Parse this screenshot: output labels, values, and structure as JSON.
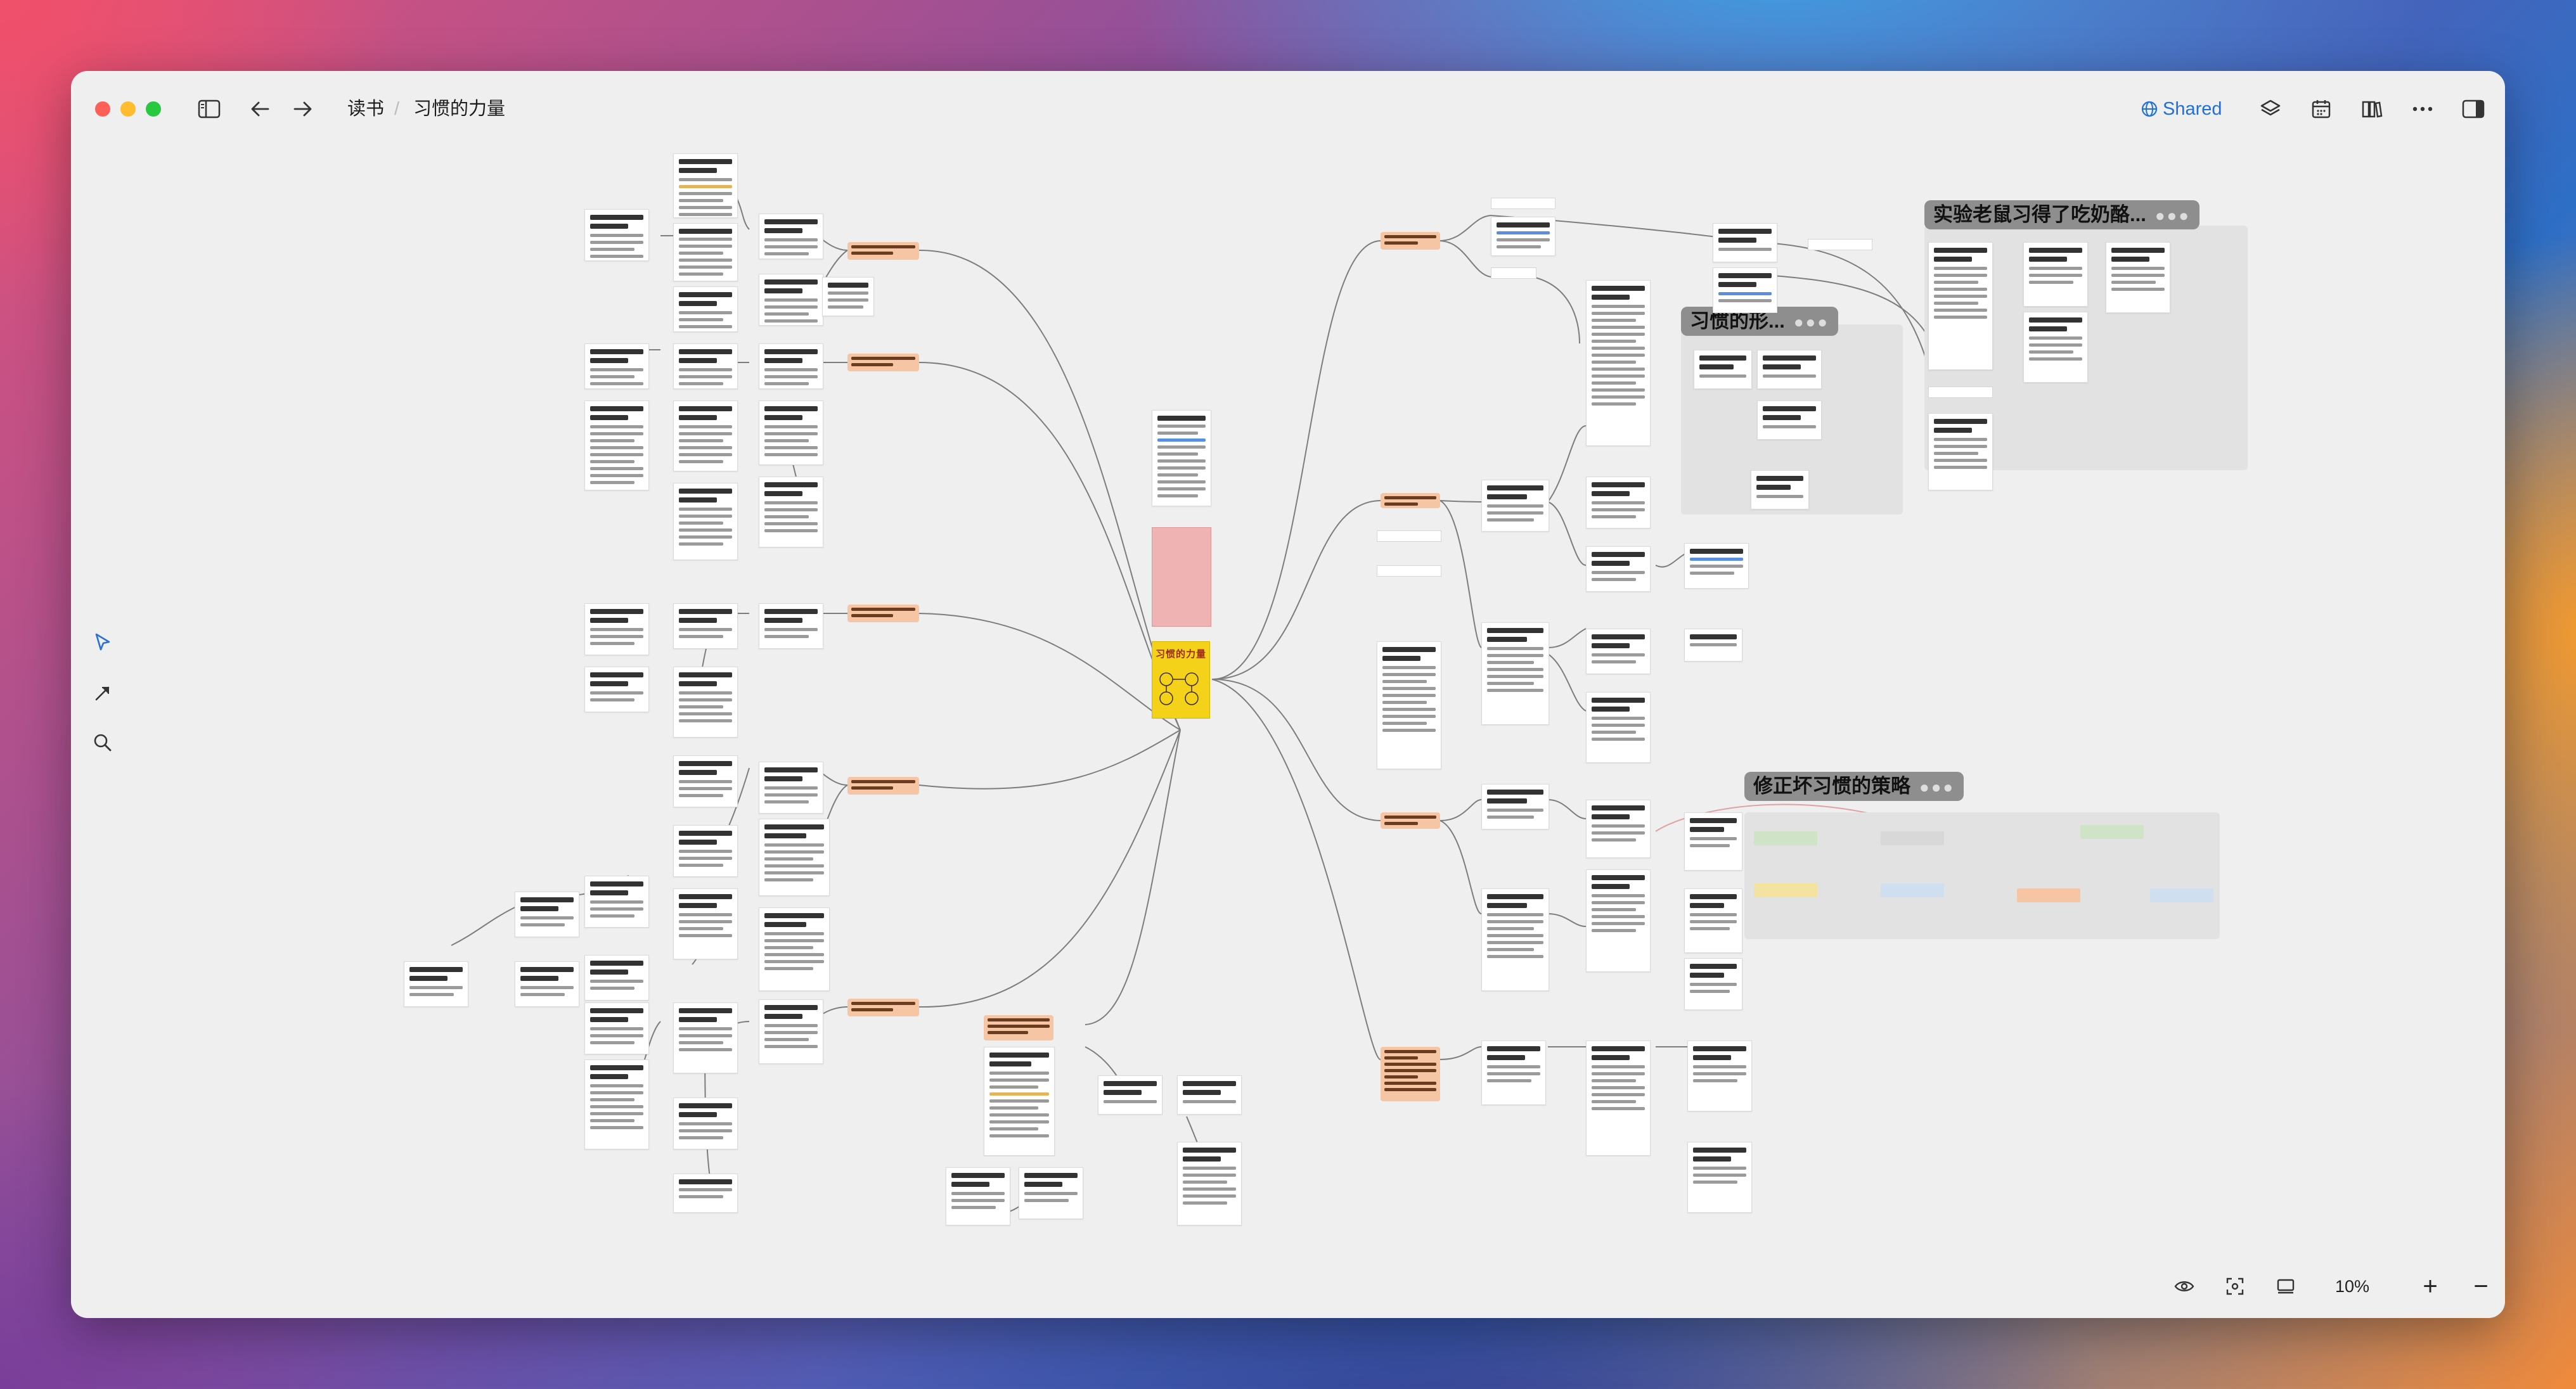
{
  "toolbar": {
    "breadcrumb": [
      "读书",
      "习惯的力量"
    ],
    "shared_label": "Shared",
    "shared_color": "#1f6fe0",
    "left_icons": [
      "sidebar-toggle-icon",
      "back-arrow-icon",
      "forward-arrow-icon"
    ],
    "right_icons": [
      "globe-icon",
      "layers-icon",
      "calendar-icon",
      "book-icon",
      "more-icon",
      "right-panel-icon"
    ]
  },
  "canvas": {
    "central_book_title": "习惯的力量",
    "group_tags": [
      "实验老鼠习得了吃奶酪...",
      "习惯的形...",
      "修正坏习惯的策略"
    ],
    "colors": {
      "topic_node": "#f6c6a4",
      "cover": "#f4d21a",
      "summary_card": "#f0b3b3",
      "group_tag": "#8e8e8e"
    }
  },
  "left_tools": [
    "pointer-icon",
    "connector-arrow-icon",
    "search-icon"
  ],
  "bottom_bar": {
    "icons": [
      "eye-icon",
      "focus-frame-icon",
      "stack-icon"
    ],
    "zoom_level": "10%",
    "zoom_in": "+",
    "zoom_out": "−"
  }
}
